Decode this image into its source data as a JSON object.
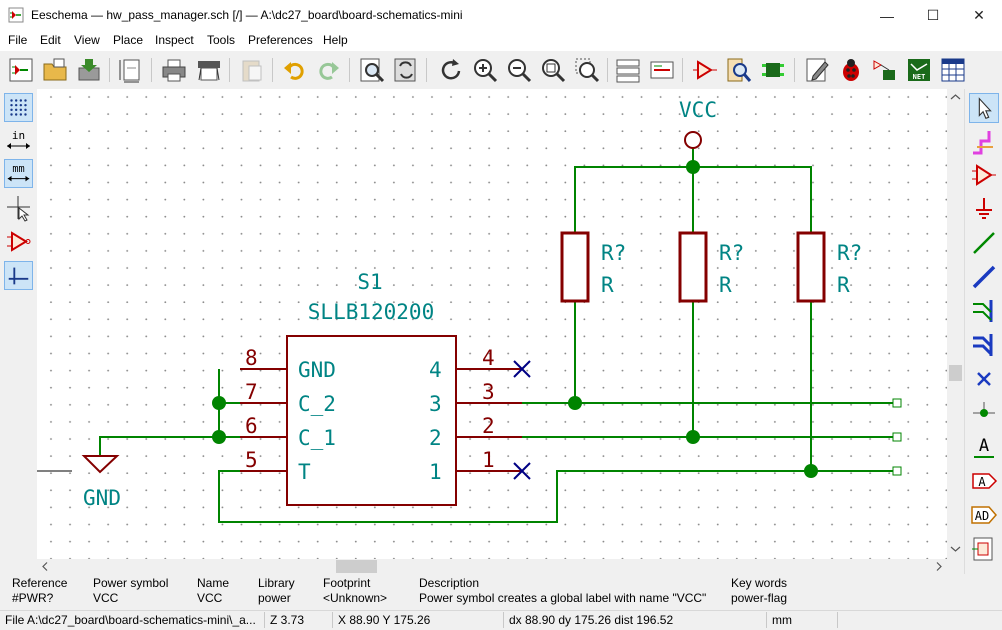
{
  "window": {
    "title": "Eeschema — hw_pass_manager.sch [/] — A:\\dc27_board\\board-schematics-mini",
    "controls": {
      "minimize": "—",
      "maximize": "☐",
      "close": "✕"
    }
  },
  "menu": [
    "File",
    "Edit",
    "View",
    "Place",
    "Inspect",
    "Tools",
    "Preferences",
    "Help"
  ],
  "toolbar": {
    "icons": [
      "schematic-setup-icon",
      "sheet-open-icon",
      "save-icon",
      "page-settings-icon",
      "print-icon",
      "plot-icon",
      "paste-icon",
      "undo-icon",
      "redo-icon",
      "find-icon",
      "find-replace-icon",
      "refresh-icon",
      "zoom-in-icon",
      "zoom-out-icon",
      "zoom-fit-icon",
      "zoom-selection-icon",
      "hierarchy-navigator-icon",
      "leave-sheet-icon",
      "symbol-editor-icon",
      "symbol-browser-icon",
      "footprint-editor-icon",
      "annotate-icon",
      "erc-bug-icon",
      "assign-footprints-icon",
      "netlist-icon",
      "bom-icon"
    ]
  },
  "left_toolbar": [
    "grid-toggle-icon",
    "units-inch-icon",
    "units-mm-icon",
    "cursor-shape-icon",
    "hidden-pins-icon",
    "line-mode-icon"
  ],
  "left_toolbar_text": {
    "in": "in",
    "mm": "mm"
  },
  "right_toolbar": [
    "select-arrow-icon",
    "highlight-net-icon",
    "add-symbol-icon",
    "add-power-icon",
    "add-wire-icon",
    "add-bus-icon",
    "wire-to-bus-icon",
    "bus-to-bus-icon",
    "no-connect-icon",
    "junction-icon",
    "add-label-icon",
    "global-label-icon",
    "hier-label-icon",
    "add-sheet-icon"
  ],
  "right_toolbar_text": {
    "label": "A",
    "global": "A",
    "hier": "AD"
  },
  "schematic": {
    "power_vcc": "VCC",
    "power_gnd": "GND",
    "ic_ref": "S1",
    "ic_value": "SLLB120200",
    "pins_left": [
      {
        "num": "8",
        "name": "GND"
      },
      {
        "num": "7",
        "name": "C_2"
      },
      {
        "num": "6",
        "name": "C_1"
      },
      {
        "num": "5",
        "name": "T"
      }
    ],
    "pins_right": [
      {
        "num": "4",
        "name": "4"
      },
      {
        "num": "3",
        "name": "3"
      },
      {
        "num": "2",
        "name": "2"
      },
      {
        "num": "1",
        "name": "1"
      }
    ],
    "resistors": [
      {
        "ref": "R?",
        "value": "R"
      },
      {
        "ref": "R?",
        "value": "R"
      },
      {
        "ref": "R?",
        "value": "R"
      }
    ],
    "colors": {
      "wire": "#008400",
      "part": "#840000",
      "power": "#008484",
      "noconnect": "#000084",
      "grid": "#848484"
    }
  },
  "info_panel": [
    {
      "label": "Reference",
      "value": "#PWR?"
    },
    {
      "label": "Power symbol",
      "value": "VCC"
    },
    {
      "label": "Name",
      "value": "VCC"
    },
    {
      "label": "Library",
      "value": "power"
    },
    {
      "label": "Footprint",
      "value": "<Unknown>"
    },
    {
      "label": "Description",
      "value": "Power symbol creates a global label with name \"VCC\""
    },
    {
      "label": "Key words",
      "value": "power-flag"
    }
  ],
  "status": {
    "file": "File A:\\dc27_board\\board-schematics-mini\\_a...",
    "zoom": "Z 3.73",
    "coords": "X 88.90  Y 175.26",
    "delta": "dx 88.90  dy 175.26  dist 196.52",
    "units": "mm"
  }
}
